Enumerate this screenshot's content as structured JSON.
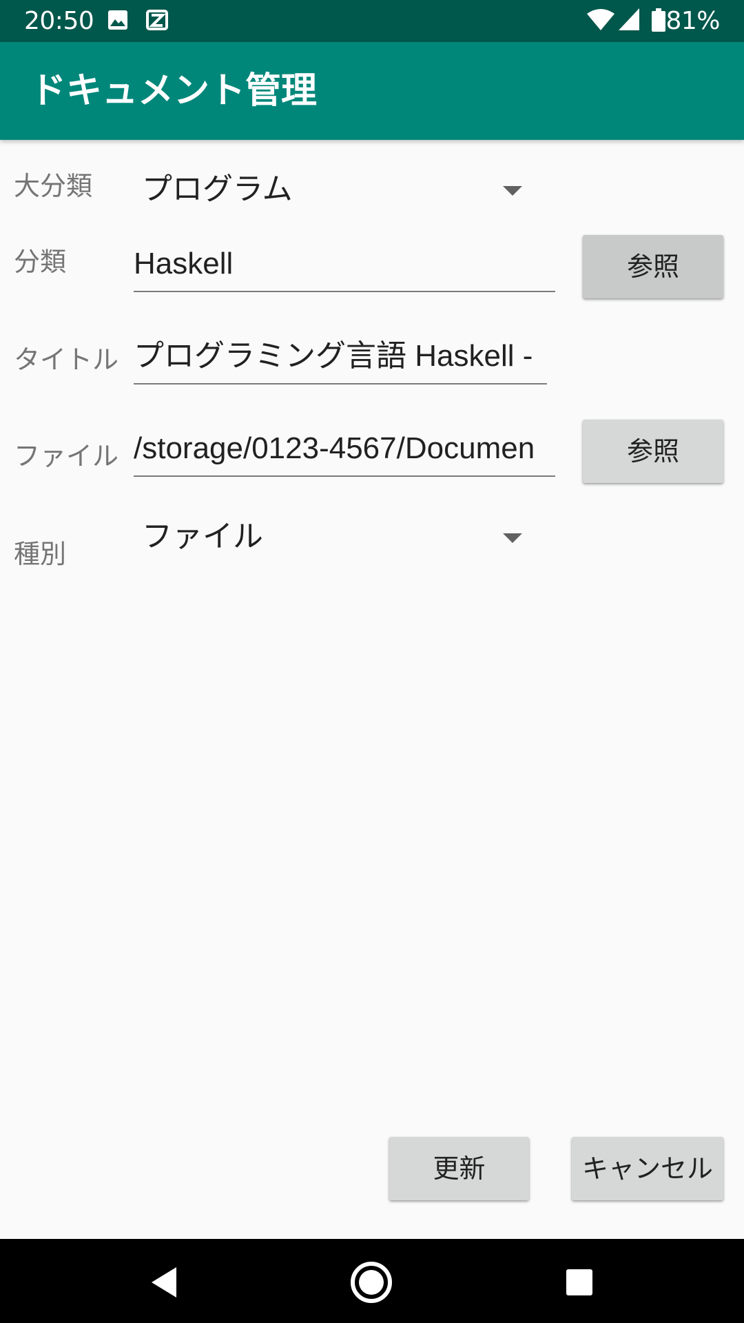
{
  "status_bar": {
    "time": "20:50",
    "battery_text": "81%",
    "icons": [
      "image-icon",
      "notification-icon",
      "wifi-icon",
      "signal-icon",
      "battery-icon"
    ]
  },
  "app_bar": {
    "title": "ドキュメント管理"
  },
  "form": {
    "major_category": {
      "label": "大分類",
      "value": "プログラム"
    },
    "category": {
      "label": "分類",
      "value": "Haskell",
      "browse_label": "参照"
    },
    "title": {
      "label": "タイトル",
      "value": "プログラミング言語 Haskell -"
    },
    "file": {
      "label": "ファイル",
      "value": "/storage/0123-4567/Documen",
      "browse_label": "参照"
    },
    "type": {
      "label": "種別",
      "value": "ファイル"
    }
  },
  "actions": {
    "update_label": "更新",
    "cancel_label": "キャンセル"
  },
  "nav_bar": {
    "icons": [
      "back-icon",
      "home-icon",
      "recents-icon"
    ]
  },
  "colors": {
    "status_bar": "#00574b",
    "app_bar": "#00877a",
    "background": "#fafafa",
    "button": "#d6d7d7"
  }
}
